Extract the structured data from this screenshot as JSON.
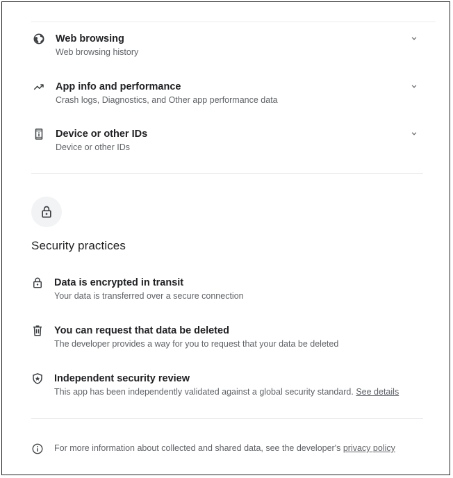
{
  "data_types": [
    {
      "title": "Web browsing",
      "desc": "Web browsing history",
      "icon": "globe-icon"
    },
    {
      "title": "App info and performance",
      "desc": "Crash logs, Diagnostics, and Other app performance data",
      "icon": "performance-icon"
    },
    {
      "title": "Device or other IDs",
      "desc": "Device or other IDs",
      "icon": "device-id-icon"
    }
  ],
  "security": {
    "title": "Security practices",
    "items": [
      {
        "title": "Data is encrypted in transit",
        "desc": "Your data is transferred over a secure connection",
        "icon": "lock-icon"
      },
      {
        "title": "You can request that data be deleted",
        "desc": "The developer provides a way for you to request that your data be deleted",
        "icon": "trash-icon"
      },
      {
        "title": "Independent security review",
        "desc": "This app has been independently validated against a global security standard.",
        "link": "See details",
        "icon": "shield-star-icon"
      }
    ]
  },
  "footer": {
    "text": "For more information about collected and shared data, see the developer's",
    "link": "privacy policy"
  },
  "colors": {
    "text": "#202124",
    "secondary": "#5f6368",
    "divider": "#e8eaed",
    "circle_bg": "#f1f3f4"
  }
}
